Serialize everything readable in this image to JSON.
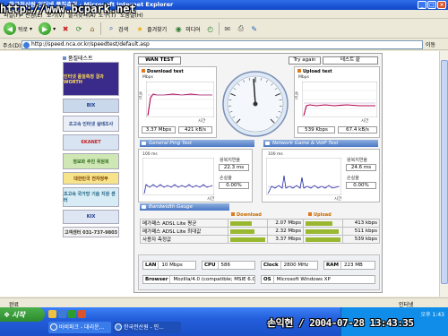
{
  "window": {
    "title": "한국전산원 인터넷 품질측정 - Microsoft Internet Explorer",
    "watermark": "http://www.bcpark.net"
  },
  "menu": [
    "파일(F)",
    "편집(E)",
    "보기(V)",
    "즐겨찾기(A)",
    "도구(T)",
    "도움말(H)"
  ],
  "toolbar": {
    "back": "뒤로",
    "search": "검색",
    "favorites": "즐겨찾기",
    "media": "미디어"
  },
  "address": {
    "label": "주소(D)",
    "url": "http://speed.nca.or.kr/speedtest/default.asp",
    "go": "이동"
  },
  "sidebar": {
    "heading": "품질테스트",
    "banners": [
      {
        "label": "인터넷 품질측정 결과 WORTH",
        "color": "#3a2a8a",
        "text_color": "#ffdd55"
      },
      {
        "label": "BIX",
        "color": "#c9d8ea",
        "text_color": "#1a3a8a"
      },
      {
        "label": "초고속 인터넷 실태조사",
        "color": "#e9eef7",
        "text_color": "#2b4c8c"
      },
      {
        "label": "6KANET",
        "color": "#d9e4f3",
        "text_color": "#c02020"
      },
      {
        "label": "정보화 추진 위원회",
        "color": "#cfe7b5",
        "text_color": "#2f6a19"
      },
      {
        "label": "대한민국 전자정부",
        "color": "#f7e48a",
        "text_color": "#7a3b00"
      },
      {
        "label": "초고속 국가망 기술 지원 센터",
        "color": "#d7ecf4",
        "text_color": "#1b5f80"
      },
      {
        "label": "KIX",
        "color": "#dde6f2",
        "text_color": "#1a3a8a"
      },
      {
        "label": "고객센터 031-737-9803",
        "color": "#f2f2f2",
        "text_color": "#333333"
      }
    ]
  },
  "main": {
    "tab": "WAN TEST",
    "try_again": "Try again",
    "end_test": "테스트 끝",
    "download": {
      "title": "Download test",
      "unit": "Mbps",
      "axis_time": "시간",
      "axis_speed": "속도",
      "mbps": "3.37 Mbps",
      "kbs": "421 kB/s"
    },
    "upload": {
      "title": "Upload test",
      "unit": "Mbps",
      "axis_time": "시간",
      "axis_speed": "속도",
      "mbps": "539 Kbps",
      "kbs": "67.4 kB/s"
    },
    "ping": {
      "title": "General Ping Test",
      "unit": "100 ms",
      "axis_time": "시간",
      "delay_label": "왕복지연율",
      "delay_value": "22.3 ms",
      "loss_label": "손실율",
      "loss_value": "0.00%"
    },
    "voip": {
      "title": "Network Game & VoIP Test",
      "unit": "100 ms",
      "axis_time": "시간",
      "delay_label": "왕복지연율",
      "delay_value": "24.6 ms",
      "loss_label": "손실율",
      "loss_value": "0.00%"
    },
    "bandwidth": {
      "title": "Bandwidth Gauge",
      "download_header": "Download",
      "upload_header": "Upload",
      "rows": [
        {
          "label": "메가패스 ADSL Lite 평균",
          "down": "2.07 Mbps",
          "down_frac": 0.61,
          "up": "413 kbps",
          "up_frac": 0.77
        },
        {
          "label": "메가패스 ADSL Lite 최대값",
          "down": "2.32 Mbps",
          "down_frac": 0.69,
          "up": "511 kbps",
          "up_frac": 0.95
        },
        {
          "label": "사용자 측정값",
          "down": "3.37 Mbps",
          "down_frac": 1.0,
          "up": "539 kbps",
          "up_frac": 1.0
        }
      ]
    },
    "sysinfo": {
      "lan_k": "LAN",
      "lan_v": "10 Mbps",
      "cpu_k": "CPU",
      "cpu_v": "586",
      "clock_k": "Clock",
      "clock_v": "2800 MHz",
      "ram_k": "RAM",
      "ram_v": "223 MB",
      "browser_k": "Browser",
      "browser_v": "Mozilla/4.0 (compatible; MSIE 6.0",
      "os_k": "OS",
      "os_v": "Microsoft Windows XP"
    }
  },
  "status": {
    "left": "완료",
    "right": "인터넷"
  },
  "taskbar": {
    "start": "시작",
    "task1": "바비파크 - 대리운...",
    "task2": "한국전산원 - 인...",
    "clock": "오후 1:43"
  },
  "stamp": "손익현 / 2004-07-28 13:43:35"
}
